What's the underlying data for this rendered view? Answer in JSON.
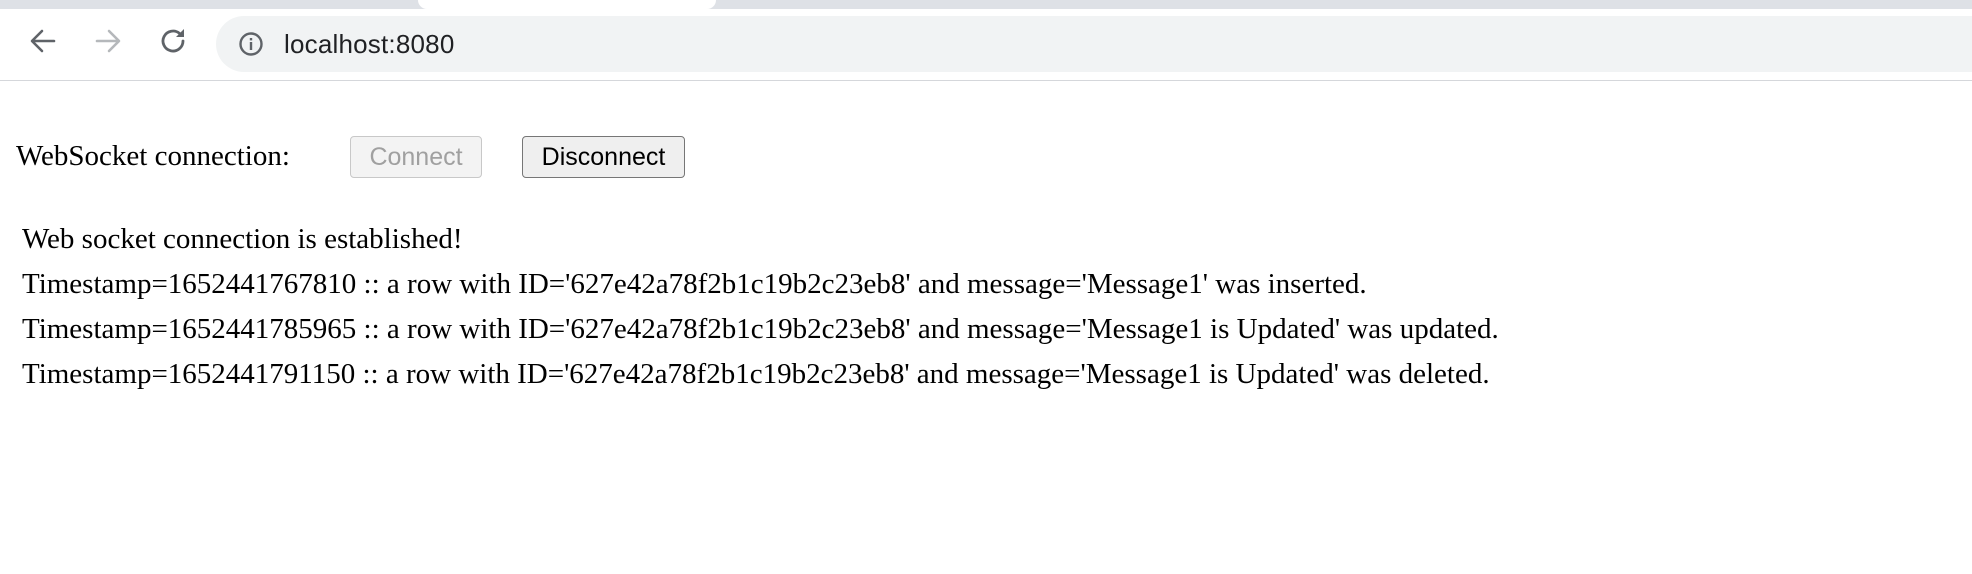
{
  "browser": {
    "url": "localhost:8080",
    "icons": {
      "back": "arrow-left-icon",
      "forward": "arrow-right-icon",
      "reload": "reload-icon",
      "site_info": "info-icon"
    }
  },
  "page": {
    "ws_label": "WebSocket connection:",
    "connect_label": "Connect",
    "connect_disabled": true,
    "disconnect_label": "Disconnect",
    "log": [
      "Web socket connection is established!",
      "Timestamp=1652441767810 :: a row with ID='627e42a78f2b1c19b2c23eb8' and message='Message1' was inserted.",
      "Timestamp=1652441785965 :: a row with ID='627e42a78f2b1c19b2c23eb8' and message='Message1 is Updated' was updated.",
      "Timestamp=1652441791150 :: a row with ID='627e42a78f2b1c19b2c23eb8' and message='Message1 is Updated' was deleted."
    ]
  }
}
